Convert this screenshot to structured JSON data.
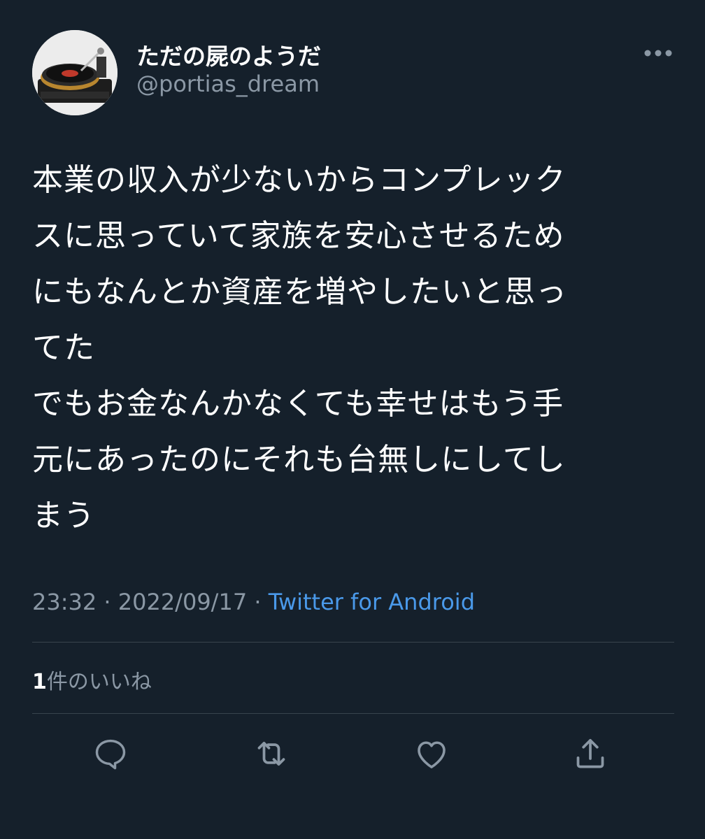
{
  "tweet": {
    "author": {
      "display_name": "ただの屍のようだ",
      "handle": "@portias_dream",
      "avatar_icon": "turntable-avatar"
    },
    "text": "本業の収入が少ないからコンプレック\nスに思っていて家族を安心させるため\nにもなんとか資産を増やしたいと思っ\nてた\nでもお金なんかなくても幸せはもう手\n元にあったのにそれも台無しにしてし\nまう",
    "time": "23:32",
    "date": "2022/09/17",
    "separator": "·",
    "source": "Twitter for Android",
    "likes": {
      "count": "1",
      "label": "件のいいね"
    }
  },
  "actions": {
    "reply_icon": "reply-icon",
    "retweet_icon": "retweet-icon",
    "like_icon": "heart-icon",
    "share_icon": "share-icon",
    "more_icon": "more-icon"
  },
  "colors": {
    "background": "#15202b",
    "text_primary": "#ffffff",
    "text_secondary": "#8b98a5",
    "link": "#4a99e9",
    "divider": "#38444d"
  }
}
